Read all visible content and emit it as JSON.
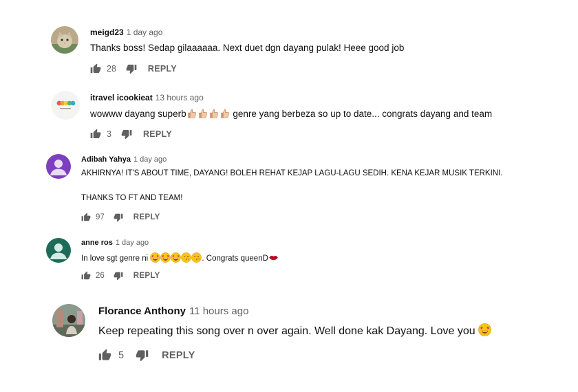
{
  "comments": [
    {
      "author": "meigd23",
      "time": "1 day ago",
      "text": "Thanks boss! Sedap gilaaaaaa. Next duet dgn dayang pulak! Heee good job",
      "likes": "28",
      "reply": "REPLY"
    },
    {
      "author": "itravel icookieat",
      "time": "13 hours ago",
      "text_before": "wowww dayang superb",
      "text_after": "genre yang berbeza so up to date... congrats dayang and team",
      "likes": "3",
      "reply": "REPLY"
    },
    {
      "author": "Adibah Yahya",
      "time": "1 day ago",
      "line1": "AKHIRNYA! IT'S ABOUT TIME, DAYANG! BOLEH REHAT KEJAP LAGU-LAGU SEDIH. KENA KEJAR MUSIK TERKINI.",
      "line2": "THANKS TO FT AND TEAM!",
      "likes": "97",
      "reply": "REPLY"
    },
    {
      "author": "anne ros",
      "time": "1 day ago",
      "text_before": "In love sgt genre ni",
      "text_after": ". Congrats queenD",
      "likes": "26",
      "reply": "REPLY"
    },
    {
      "author": "Florance Anthony",
      "time": "11 hours ago",
      "text": "Keep repeating this song over n over again. Well done kak Dayang. Love you",
      "likes": "5",
      "reply": "REPLY"
    }
  ],
  "icons": {
    "like": "thumbs-up-icon",
    "dislike": "thumbs-down-icon",
    "emoji_heart_eyes": "heart-eyes-emoji",
    "emoji_thumbs": "thumbs-up-emoji",
    "emoji_kiss": "kissing-emoji",
    "emoji_lips": "lips-emoji"
  },
  "colors": {
    "author": "#0f0f0f",
    "meta": "#606060",
    "avatar_purple": "#7b3fbf",
    "avatar_teal": "#1f6b59"
  }
}
